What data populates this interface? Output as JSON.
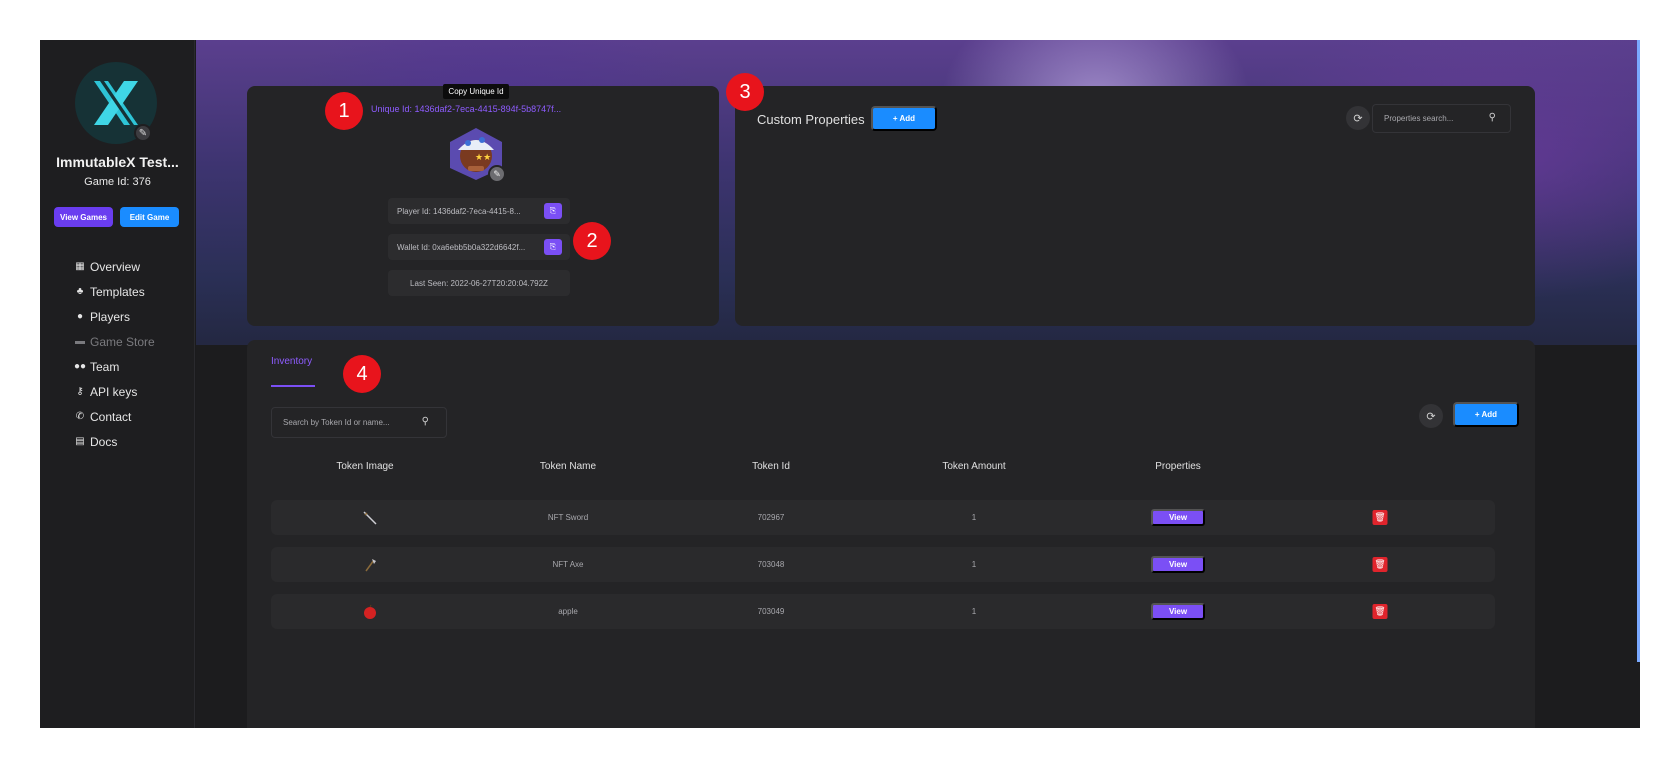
{
  "sidebar": {
    "game_name": "ImmutableX Test...",
    "game_id": "Game Id: 376",
    "buttons": {
      "view_games": "View Games",
      "edit_game": "Edit Game"
    },
    "items": [
      {
        "label": "Overview",
        "icon": "grid-icon"
      },
      {
        "label": "Templates",
        "icon": "shapes-icon"
      },
      {
        "label": "Players",
        "icon": "user-icon"
      },
      {
        "label": "Game Store",
        "icon": "store-icon"
      },
      {
        "label": "Team",
        "icon": "users-icon"
      },
      {
        "label": "API keys",
        "icon": "key-icon"
      },
      {
        "label": "Contact",
        "icon": "phone-icon"
      },
      {
        "label": "Docs",
        "icon": "document-icon"
      }
    ]
  },
  "player": {
    "tooltip": "Copy Unique Id",
    "unique_id": "Unique Id: 1436daf2-7eca-4415-894f-5b8747f...",
    "player_id": "Player Id: 1436daf2-7eca-4415-8...",
    "wallet_id": "Wallet Id: 0xa6ebb5b0a322d6642f...",
    "last_seen": "Last Seen: 2022-06-27T20:20:04.792Z"
  },
  "properties": {
    "title": "Custom Properties",
    "add_label": "+ Add",
    "search_placeholder": "Properties search..."
  },
  "inventory": {
    "tab": "Inventory",
    "search_placeholder": "Search by Token Id or name...",
    "add_label": "+ Add",
    "columns": [
      "Token Image",
      "Token Name",
      "Token Id",
      "Token Amount",
      "Properties"
    ],
    "rows": [
      {
        "name": "NFT Sword",
        "token_id": "702967",
        "amount": "1",
        "view": "View",
        "image": "sword"
      },
      {
        "name": "NFT Axe",
        "token_id": "703048",
        "amount": "1",
        "view": "View",
        "image": "axe"
      },
      {
        "name": "apple",
        "token_id": "703049",
        "amount": "1",
        "view": "View",
        "image": "apple"
      }
    ]
  },
  "markers": [
    "1",
    "2",
    "3",
    "4"
  ],
  "colors": {
    "accent_purple": "#7b4ff5",
    "accent_blue": "#1a8cff",
    "danger": "#e0242c",
    "marker": "#e8141c"
  }
}
